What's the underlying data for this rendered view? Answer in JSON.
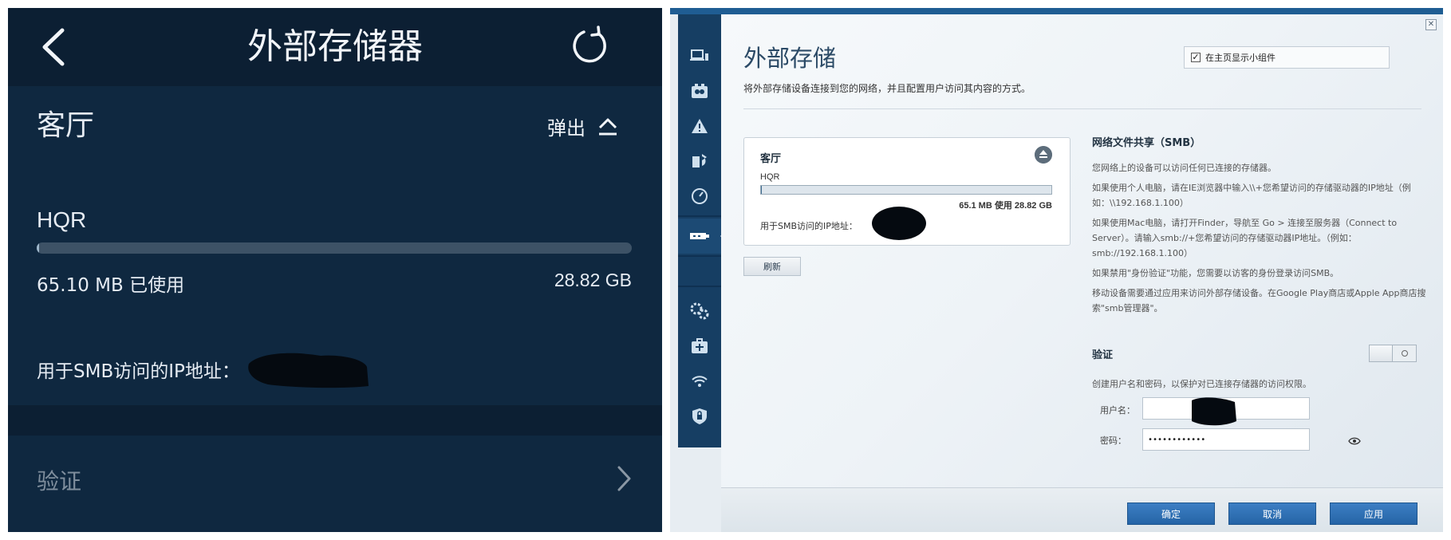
{
  "mobile": {
    "title": "外部存储器",
    "room": "客厅",
    "eject_label": "弹出",
    "drive_name": "HQR",
    "usage_fraction": 0.0022,
    "used_text": "65.10 MB 已使用",
    "total_text": "28.82 GB",
    "ip_label": "用于SMB访问的IP地址：",
    "auth_label": "验证"
  },
  "web": {
    "title": "外部存储",
    "subtitle": "将外部存储设备连接到您的网络，并且配置用户访问其内容的方式。",
    "show_widget_label": "在主页显示小组件",
    "show_widget_checked": true,
    "device": {
      "room": "客厅",
      "drive_name": "HQR",
      "usage_fraction": 0.0022,
      "usage_text": "65.1 MB 使用 28.82 GB",
      "ip_label": "用于SMB访问的IP地址："
    },
    "refresh_label": "刷新",
    "smb": {
      "heading": "网络文件共享（SMB）",
      "p1": "您网络上的设备可以访问任何已连接的存储器。",
      "p2": "如果使用个人电脑，请在IE浏览器中输入\\\\+您希望访问的存储驱动器的IP地址（例如：\\\\192.168.1.100）",
      "p3": "如果使用Mac电脑，请打开Finder，导航至 Go > 连接至服务器（Connect to Server）。请输入smb://+您希望访问的存储驱动器IP地址。（例如：smb://192.168.1.100）",
      "p4": "如果禁用\"身份验证\"功能，您需要以访客的身份登录访问SMB。",
      "p5": "移动设备需要通过应用来访问外部存储设备。在Google Play商店或Apple App商店搜索\"smb管理器\"。"
    },
    "verify": {
      "heading": "验证",
      "desc": "创建用户名和密码，以保护对已连接存储器的访问权限。",
      "username_label": "用户名：",
      "username_value": "",
      "password_label": "密码：",
      "password_value": "••••••••••••"
    },
    "buttons": {
      "ok": "确定",
      "cancel": "取消",
      "apply": "应用"
    },
    "sidebar_icons": [
      "devices-icon",
      "parental-icon",
      "alert-icon",
      "priority-icon",
      "speed-icon",
      "usb-icon",
      "settings-icon",
      "troubleshoot-icon",
      "wifi-icon",
      "security-icon"
    ],
    "accent_color": "#2564a6",
    "sidebar_color": "#163e63"
  }
}
